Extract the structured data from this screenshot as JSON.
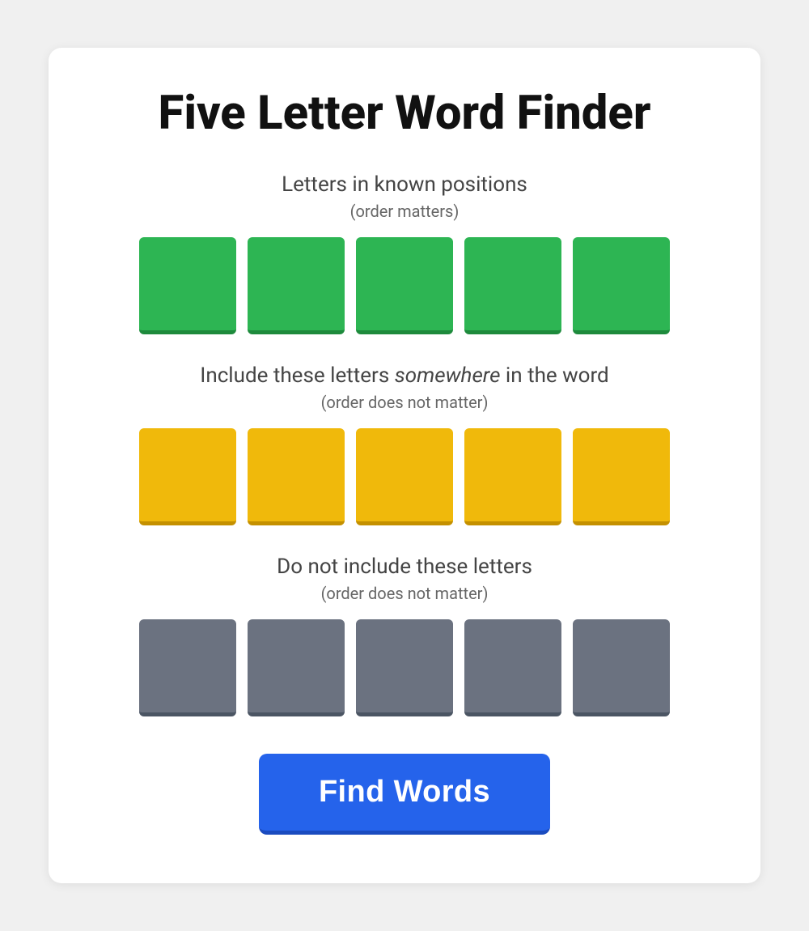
{
  "page": {
    "title": "Five Letter Word Finder"
  },
  "sections": {
    "known": {
      "title": "Letters in known positions",
      "subtitle": "(order matters)",
      "tiles": [
        "",
        "",
        "",
        "",
        ""
      ],
      "color": "green"
    },
    "include": {
      "title_plain": "Include these letters ",
      "title_italic": "somewhere",
      "title_end": " in the word",
      "subtitle": "(order does not matter)",
      "tiles": [
        "",
        "",
        "",
        "",
        ""
      ],
      "color": "yellow"
    },
    "exclude": {
      "title": "Do not include these letters",
      "subtitle": "(order does not matter)",
      "tiles": [
        "",
        "",
        "",
        "",
        ""
      ],
      "color": "gray"
    }
  },
  "button": {
    "label": "Find Words"
  }
}
